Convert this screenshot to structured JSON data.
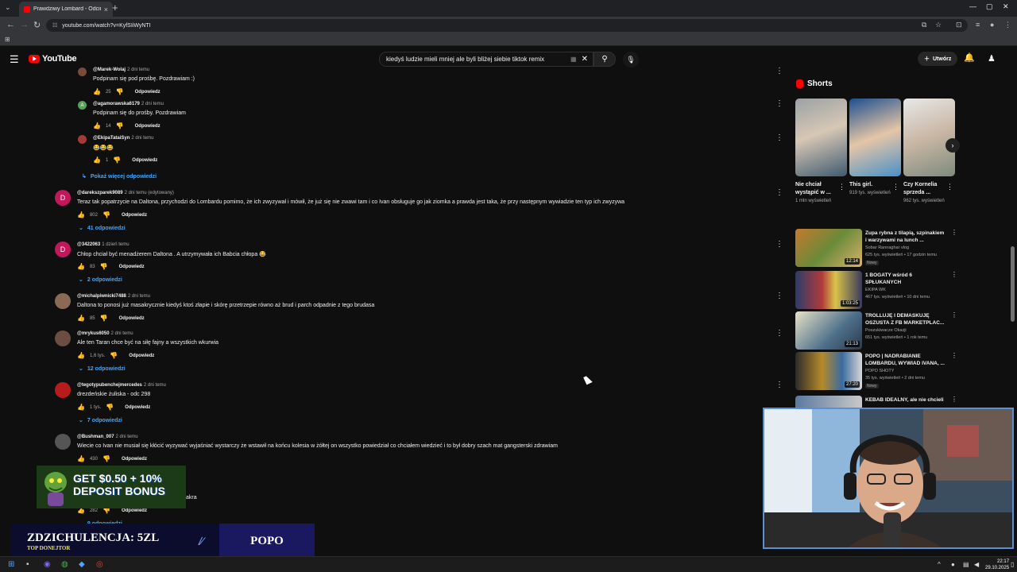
{
  "browser": {
    "tab_title": "Prawdziwy Lombard - Odcinek",
    "url": "youtube.com/watch?v=KyfSIiWyNTI",
    "tab_close": "×",
    "new_tab": "+"
  },
  "yt": {
    "logo_text": "YouTube",
    "search_query": "kiedyś ludzie mieli mniej ale byli bliżej siebie tiktok remix",
    "create_label": "Utwórz"
  },
  "comments": [
    {
      "author": "@Marek-Wolaj",
      "time": "2 dni temu",
      "text": "Podpinam się pod prośbę. Pozdrawiam :)",
      "likes": "25",
      "reply": "Odpowiedz"
    },
    {
      "author": "@agamorawska6179",
      "time": "2 dni temu",
      "text": "Podpinam się do prośby. Pozdrawiam",
      "likes": "14",
      "reply": "Odpowiedz",
      "avatar_letter": "A"
    },
    {
      "author": "@EkipaTataiSyn",
      "time": "2 dni temu",
      "text": "😂😂😂",
      "likes": "1",
      "reply": "Odpowiedz"
    },
    {
      "author": "@darekszparek9089",
      "time": "2 dni temu (edytowany)",
      "text": "Teraz tak popatrzycie na Daltona, przychodzi do Lombardu pomimo, że ich zwyzywał i mówił, że już się nie zwawi tam i co Ivan obsługuje go jak ziomka a prawda jest taka, że przy następnym wywiadzie ten typ ich zwyzywa",
      "likes": "802",
      "reply": "Odpowiedz",
      "avatar_letter": "D",
      "replies": "41 odpowiedzi"
    },
    {
      "author": "@3422063",
      "time": "1 dzień temu",
      "text": "Chłop chciał być menadżerem Daltona . A utrzymywała ich Babcia chłopa 😂",
      "likes": "83",
      "reply": "Odpowiedz",
      "avatar_letter": "D",
      "replies": "2 odpowiedzi"
    },
    {
      "author": "@michalpiwnicki7488",
      "time": "2 dni temu",
      "text": "Daltona to ponosi już masakrycznie kiedyś ktoś złapie i skórę przetrzepie równo aż brud i parch odpadnie z tego brudasa",
      "likes": "85",
      "reply": "Odpowiedz"
    },
    {
      "author": "@mrykus6050",
      "time": "2 dni temu",
      "text": "Ale ten Taran chce być na siłę fajny a wszystkich wkurwia",
      "likes": "1,6 tys.",
      "reply": "Odpowiedz",
      "replies": "12 odpowiedzi"
    },
    {
      "author": "@tegotypubenchejmercedes",
      "time": "2 dni temu",
      "text": "drezdeńskie żuliska - odc 298",
      "likes": "1 tys.",
      "reply": "Odpowiedz",
      "replies": "7 odpowiedzi"
    },
    {
      "author": "@Bushman_007",
      "time": "2 dni temu",
      "text": "Wiecie co Ivan nie musiał się kłócić wyzywać wyjaśniać wystarczy że wstawił na końcu kolesia w żółtej on wszystko powiedział co chciałem wiedzieć i to był dobry szach mat gangsterski zdrawiam",
      "likes": "430",
      "reply": "Odpowiedz"
    },
    {
      "text_partial": "akra",
      "likes": "282",
      "reply": "Odpowiedz",
      "replies": "9 odpowiedzi"
    }
  ],
  "show_more_replies": "Pokaż więcej odpowiedzi",
  "shorts": {
    "title": "Shorts",
    "items": [
      {
        "title": "Nie chciał wystąpić w ...",
        "views": "1 mln wyświetleń"
      },
      {
        "title": "This girl.",
        "views": "919 tys. wyświetleń"
      },
      {
        "title": "Czy Kornelia sprzeda ...",
        "views": "962 tys. wyświetleń"
      }
    ]
  },
  "recommendations": [
    {
      "title": "Zupa rybna z tilapią, szpinakiem i warzywami na lunch ...",
      "channel": "Sobar Rannaghar vlog",
      "meta": "625 tys. wyświetleń • 17 godzin temu",
      "badge": "Nowy",
      "duration": "12:14"
    },
    {
      "title": "1 BOGATY wśród 6 SPŁUKANYCH",
      "channel": "EKIPA WK",
      "meta": "467 tys. wyświetleń • 10 dni temu",
      "duration": "1:03:25"
    },
    {
      "title": "TROLLUJĘ I DEMASKUJĘ OSZUSTA Z FB MARKETPLAC...",
      "channel": "Poszukiwacze Okazji",
      "meta": "651 tys. wyświetleń • 1 rok temu",
      "duration": "21:13"
    },
    {
      "title": "POPO | NADRABIANIE LOMBARDU, WYWIAD IVANA, ...",
      "channel": "POPO SHOTY",
      "meta": "35 tys. wyświetleń • 2 dni temu",
      "badge": "Nowy",
      "duration": "27:20"
    },
    {
      "title": "KEBAB IDEALNY, ale nie chcieli ...",
      "channel": "",
      "meta": ""
    }
  ],
  "overlay": {
    "ad_text": "GET $0.50 + 10% DEPOSIT BONUS",
    "donate_main": "ZDZICHULENCJA: 5ZL",
    "donate_sub": "TOP DONEJTOR",
    "donate_name": "POPO"
  },
  "taskbar": {
    "time": "22:17",
    "date": "29.10.2025"
  }
}
